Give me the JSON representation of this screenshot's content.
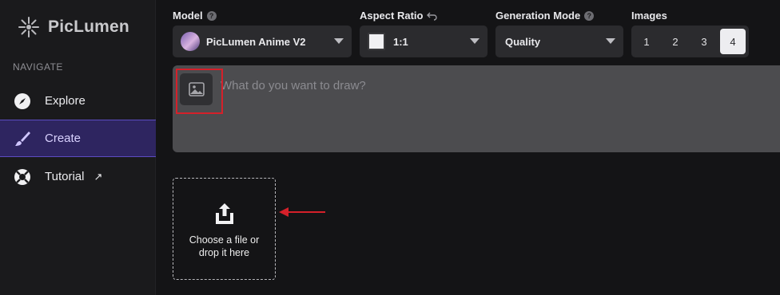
{
  "app": {
    "name": "PicLumen"
  },
  "sidebar": {
    "heading": "NAVIGATE",
    "items": [
      {
        "label": "Explore",
        "icon": "compass-icon"
      },
      {
        "label": "Create",
        "icon": "brush-icon",
        "active": true
      },
      {
        "label": "Tutorial",
        "icon": "lifebuoy-icon",
        "external": "↗"
      }
    ]
  },
  "controls": {
    "model": {
      "label": "Model",
      "value": "PicLumen Anime V2"
    },
    "aspect_ratio": {
      "label": "Aspect Ratio",
      "value": "1:1"
    },
    "generation_mode": {
      "label": "Generation Mode",
      "value": "Quality"
    },
    "images": {
      "label": "Images",
      "options": [
        "1",
        "2",
        "3",
        "4"
      ],
      "selected": "4"
    }
  },
  "prompt": {
    "placeholder": "What do you want to draw?"
  },
  "upload": {
    "text": "Choose a file or drop it here"
  },
  "colors": {
    "accent": "#2e2560",
    "highlight": "#d5202a"
  }
}
